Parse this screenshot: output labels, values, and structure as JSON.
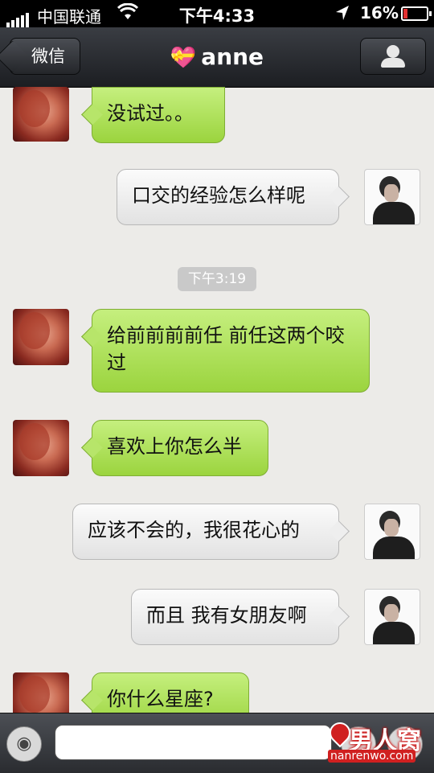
{
  "status_bar": {
    "carrier": "中国联通",
    "time": "下午4:33",
    "battery": "16%"
  },
  "nav": {
    "back_label": "微信",
    "title": "anne",
    "title_icon": "heart-gift-icon"
  },
  "messages": [
    {
      "from": "anne",
      "text": "没试过。。"
    },
    {
      "from": "me",
      "text": "口交的经验怎么样呢"
    },
    {
      "from": "anne",
      "text": "给前前前前任 前任这两个咬过"
    },
    {
      "from": "anne",
      "text": "喜欢上你怎么半"
    },
    {
      "from": "me",
      "text": "应该不会的，我很花心的"
    },
    {
      "from": "me",
      "text": "而且 我有女朋友啊"
    },
    {
      "from": "anne",
      "text": "你什么星座?"
    }
  ],
  "timestamp": "下午3:19",
  "input": {
    "value": "",
    "placeholder": ""
  },
  "watermark": {
    "logo": "男人窝",
    "url": "nanrenwo.com"
  },
  "colors": {
    "incoming_bubble": "#a8dc52",
    "outgoing_bubble": "#f0f0f0",
    "nav_bg": "#2a2c30"
  }
}
